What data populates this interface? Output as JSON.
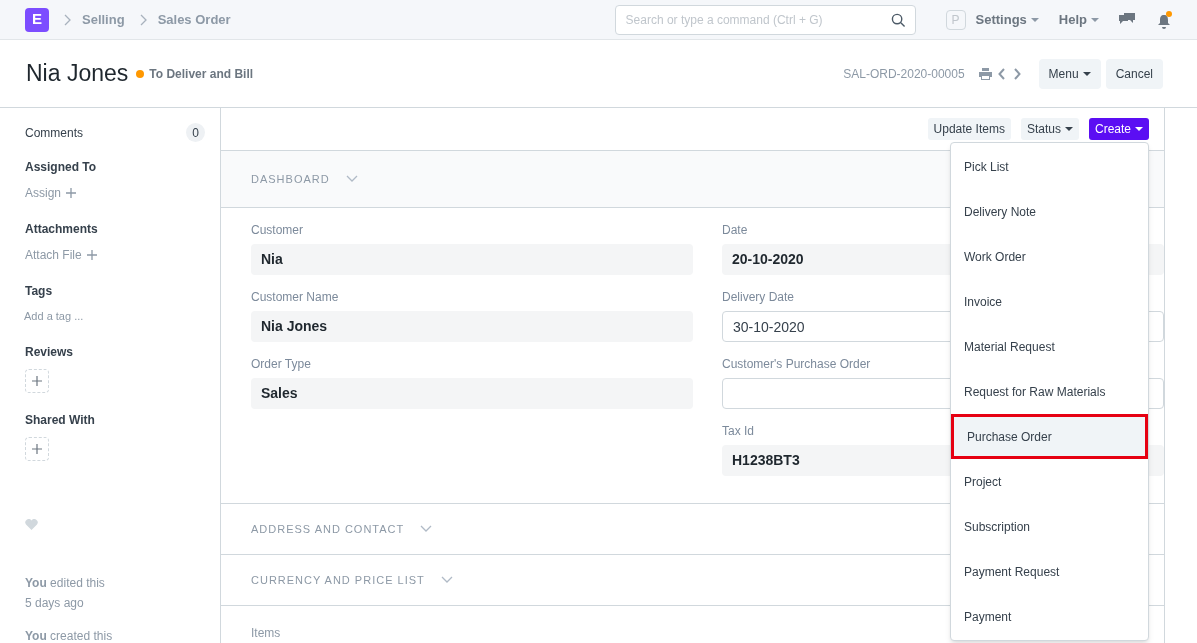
{
  "topbar": {
    "logo": "E",
    "breadcrumbs": [
      "Selling",
      "Sales Order"
    ],
    "search": {
      "placeholder": "Search or type a command (Ctrl + G)"
    },
    "avatar": "P",
    "menus": [
      "Settings",
      "Help"
    ]
  },
  "header": {
    "title": "Nia Jones",
    "status": {
      "label": "To Deliver and Bill",
      "color": "#ff9800"
    },
    "doc_id": "SAL-ORD-2020-00005",
    "buttons": [
      {
        "label": "Menu",
        "kind": "dropdown"
      },
      {
        "label": "Cancel",
        "kind": "plain"
      }
    ]
  },
  "sidebar": {
    "comments": {
      "label": "Comments",
      "count": "0"
    },
    "sections": [
      {
        "title": "Assigned To",
        "kind": "link",
        "action": "Assign"
      },
      {
        "title": "Attachments",
        "kind": "link",
        "action": "Attach File"
      },
      {
        "title": "Tags",
        "kind": "text",
        "action": "Add a tag ..."
      },
      {
        "title": "Reviews",
        "kind": "add"
      },
      {
        "title": "Shared With",
        "kind": "add"
      }
    ],
    "activity": [
      "**You** edited this",
      "5 days ago",
      "**You** created this"
    ]
  },
  "toolbar": [
    {
      "label": "Update Items",
      "kind": "plain"
    },
    {
      "label": "Status",
      "kind": "dropdown"
    },
    {
      "label": "Create",
      "kind": "primary"
    }
  ],
  "dashboard": "DASHBOARD",
  "fields_left": [
    {
      "label": "Customer",
      "value": "Nia",
      "kind": "readonly"
    },
    {
      "label": "Customer Name",
      "value": "Nia Jones",
      "kind": "readonly"
    },
    {
      "label": "Order Type",
      "value": "Sales",
      "kind": "readonly"
    }
  ],
  "fields_right": [
    {
      "label": "Date",
      "value": "20-10-2020",
      "kind": "readonly"
    },
    {
      "label": "Delivery Date",
      "value": "30-10-2020",
      "kind": "input"
    },
    {
      "label": "Customer's Purchase Order",
      "kind": "input"
    },
    {
      "label": "Tax Id",
      "value": "H1238BT3",
      "kind": "readonly"
    }
  ],
  "sections": [
    "ADDRESS AND CONTACT",
    "CURRENCY AND PRICE LIST"
  ],
  "items_label": "Items",
  "create_menu": [
    {
      "label": "Pick List",
      "selected": false
    },
    {
      "label": "Delivery Note",
      "selected": false
    },
    {
      "label": "Work Order",
      "selected": false
    },
    {
      "label": "Invoice",
      "selected": false
    },
    {
      "label": "Material Request",
      "selected": false
    },
    {
      "label": "Request for Raw Materials",
      "selected": false
    },
    {
      "label": "Purchase Order",
      "selected": true
    },
    {
      "label": "Project",
      "selected": false
    },
    {
      "label": "Subscription",
      "selected": false
    },
    {
      "label": "Payment Request",
      "selected": false
    },
    {
      "label": "Payment",
      "selected": false
    }
  ]
}
